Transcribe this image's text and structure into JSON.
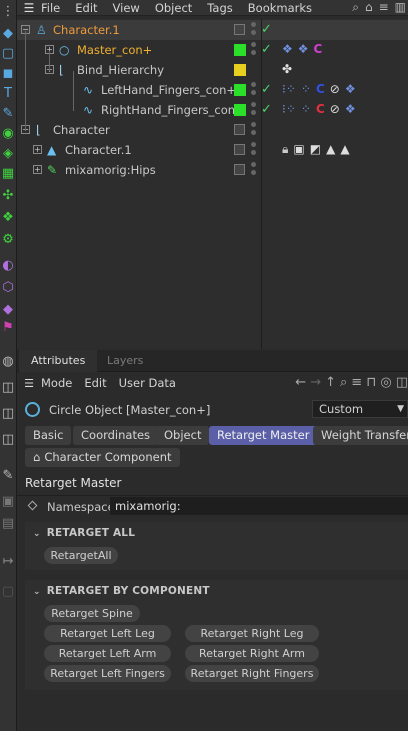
{
  "menubar": {
    "items": [
      "File",
      "Edit",
      "View",
      "Object",
      "Tags",
      "Bookmarks"
    ],
    "right_icons": [
      "search-icon",
      "home-icon",
      "filter-icon",
      "view-options-icon"
    ]
  },
  "objects": [
    {
      "name": "Character.1",
      "color": "#f09a3c",
      "icon": "character-icon",
      "layer_flag": "none",
      "selected": true
    },
    {
      "name": "Master_con+",
      "color": "#f0b030",
      "icon": "circle-spline-icon",
      "layer_flag": "#2ae02a",
      "tags": [
        "python-tag",
        "python-tag",
        "constraint-tag"
      ]
    },
    {
      "name": "Bind_Hierarchy",
      "color": "#c8c8c8",
      "icon": "null-object-icon",
      "layer_flag": "#e8d020",
      "tags": [
        "xpresso-tag"
      ]
    },
    {
      "name": "LeftHand_Fingers_con+",
      "color": "#c8c8c8",
      "icon": "spline-icon",
      "layer_flag": "#2ae02a",
      "tags": [
        "ik-tag",
        "ik-tag",
        "constraint-tag",
        "protection-tag",
        "python-tag"
      ]
    },
    {
      "name": "RightHand_Fingers_con+",
      "color": "#c8c8c8",
      "icon": "spline-icon",
      "layer_flag": "#2ae02a",
      "tags": [
        "ik-tag",
        "ik-tag",
        "constraint-tag",
        "protection-tag",
        "python-tag"
      ]
    },
    {
      "name": "Character",
      "color": "#c8c8c8",
      "icon": "null-object-icon",
      "layer_flag": "none"
    },
    {
      "name": "Character.1",
      "color": "#c8c8c8",
      "icon": "character-object-icon",
      "layer_flag": "none",
      "tags": [
        "lock-tag",
        "display-tag",
        "phong-tag",
        "material-tag",
        "material-tag"
      ]
    },
    {
      "name": "mixamorig:Hips",
      "color": "#c8c8c8",
      "icon": "joint-icon",
      "layer_flag": "none"
    }
  ],
  "attributes": {
    "tabs": [
      "Attributes",
      "Layers"
    ],
    "menu": [
      "Mode",
      "Edit",
      "User Data"
    ],
    "object_title": "Circle Object [Master_con+]",
    "preset": "Custom",
    "page_tabs": [
      "Basic",
      "Coordinates",
      "Object",
      "Retarget Master",
      "Weight Transfer"
    ],
    "page_tab2": "Character Component",
    "active_tab": "Retarget Master",
    "section_title": "Retarget Master",
    "namespace_label": "Namespace",
    "namespace_value": "mixamorig:",
    "group1": {
      "title": "RETARGET ALL",
      "buttons": [
        "RetargetAll"
      ]
    },
    "group2": {
      "title": "RETARGET BY COMPONENT",
      "buttons": [
        "Retarget Spine",
        "Retarget Left Leg",
        "Retarget Right Leg",
        "Retarget Left Arm",
        "Retarget Right Arm",
        "Retarget Left Fingers",
        "Retarget Right Fingers"
      ]
    }
  }
}
